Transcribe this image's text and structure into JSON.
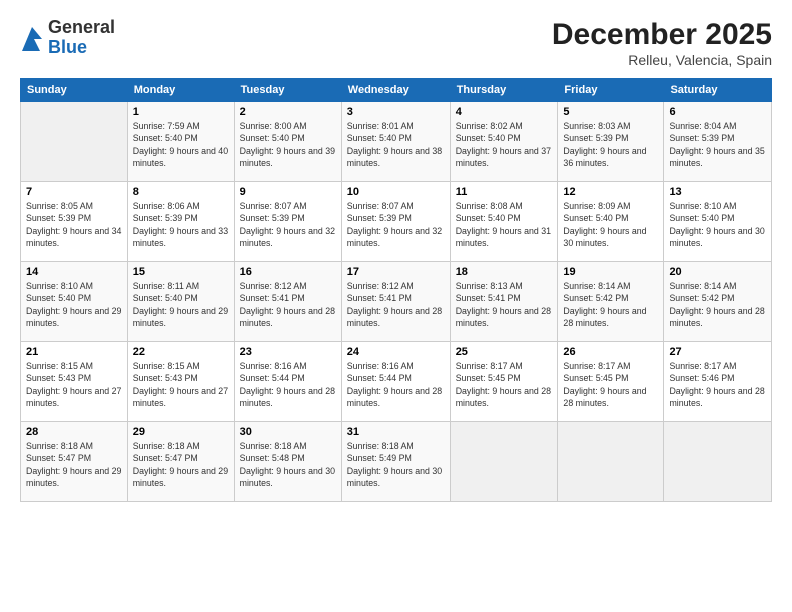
{
  "header": {
    "logo_general": "General",
    "logo_blue": "Blue",
    "month_title": "December 2025",
    "location": "Relleu, Valencia, Spain"
  },
  "days_of_week": [
    "Sunday",
    "Monday",
    "Tuesday",
    "Wednesday",
    "Thursday",
    "Friday",
    "Saturday"
  ],
  "weeks": [
    [
      {
        "day": "",
        "sunrise": "",
        "sunset": "",
        "daylight": ""
      },
      {
        "day": "1",
        "sunrise": "Sunrise: 7:59 AM",
        "sunset": "Sunset: 5:40 PM",
        "daylight": "Daylight: 9 hours and 40 minutes."
      },
      {
        "day": "2",
        "sunrise": "Sunrise: 8:00 AM",
        "sunset": "Sunset: 5:40 PM",
        "daylight": "Daylight: 9 hours and 39 minutes."
      },
      {
        "day": "3",
        "sunrise": "Sunrise: 8:01 AM",
        "sunset": "Sunset: 5:40 PM",
        "daylight": "Daylight: 9 hours and 38 minutes."
      },
      {
        "day": "4",
        "sunrise": "Sunrise: 8:02 AM",
        "sunset": "Sunset: 5:40 PM",
        "daylight": "Daylight: 9 hours and 37 minutes."
      },
      {
        "day": "5",
        "sunrise": "Sunrise: 8:03 AM",
        "sunset": "Sunset: 5:39 PM",
        "daylight": "Daylight: 9 hours and 36 minutes."
      },
      {
        "day": "6",
        "sunrise": "Sunrise: 8:04 AM",
        "sunset": "Sunset: 5:39 PM",
        "daylight": "Daylight: 9 hours and 35 minutes."
      }
    ],
    [
      {
        "day": "7",
        "sunrise": "Sunrise: 8:05 AM",
        "sunset": "Sunset: 5:39 PM",
        "daylight": "Daylight: 9 hours and 34 minutes."
      },
      {
        "day": "8",
        "sunrise": "Sunrise: 8:06 AM",
        "sunset": "Sunset: 5:39 PM",
        "daylight": "Daylight: 9 hours and 33 minutes."
      },
      {
        "day": "9",
        "sunrise": "Sunrise: 8:07 AM",
        "sunset": "Sunset: 5:39 PM",
        "daylight": "Daylight: 9 hours and 32 minutes."
      },
      {
        "day": "10",
        "sunrise": "Sunrise: 8:07 AM",
        "sunset": "Sunset: 5:39 PM",
        "daylight": "Daylight: 9 hours and 32 minutes."
      },
      {
        "day": "11",
        "sunrise": "Sunrise: 8:08 AM",
        "sunset": "Sunset: 5:40 PM",
        "daylight": "Daylight: 9 hours and 31 minutes."
      },
      {
        "day": "12",
        "sunrise": "Sunrise: 8:09 AM",
        "sunset": "Sunset: 5:40 PM",
        "daylight": "Daylight: 9 hours and 30 minutes."
      },
      {
        "day": "13",
        "sunrise": "Sunrise: 8:10 AM",
        "sunset": "Sunset: 5:40 PM",
        "daylight": "Daylight: 9 hours and 30 minutes."
      }
    ],
    [
      {
        "day": "14",
        "sunrise": "Sunrise: 8:10 AM",
        "sunset": "Sunset: 5:40 PM",
        "daylight": "Daylight: 9 hours and 29 minutes."
      },
      {
        "day": "15",
        "sunrise": "Sunrise: 8:11 AM",
        "sunset": "Sunset: 5:40 PM",
        "daylight": "Daylight: 9 hours and 29 minutes."
      },
      {
        "day": "16",
        "sunrise": "Sunrise: 8:12 AM",
        "sunset": "Sunset: 5:41 PM",
        "daylight": "Daylight: 9 hours and 28 minutes."
      },
      {
        "day": "17",
        "sunrise": "Sunrise: 8:12 AM",
        "sunset": "Sunset: 5:41 PM",
        "daylight": "Daylight: 9 hours and 28 minutes."
      },
      {
        "day": "18",
        "sunrise": "Sunrise: 8:13 AM",
        "sunset": "Sunset: 5:41 PM",
        "daylight": "Daylight: 9 hours and 28 minutes."
      },
      {
        "day": "19",
        "sunrise": "Sunrise: 8:14 AM",
        "sunset": "Sunset: 5:42 PM",
        "daylight": "Daylight: 9 hours and 28 minutes."
      },
      {
        "day": "20",
        "sunrise": "Sunrise: 8:14 AM",
        "sunset": "Sunset: 5:42 PM",
        "daylight": "Daylight: 9 hours and 28 minutes."
      }
    ],
    [
      {
        "day": "21",
        "sunrise": "Sunrise: 8:15 AM",
        "sunset": "Sunset: 5:43 PM",
        "daylight": "Daylight: 9 hours and 27 minutes."
      },
      {
        "day": "22",
        "sunrise": "Sunrise: 8:15 AM",
        "sunset": "Sunset: 5:43 PM",
        "daylight": "Daylight: 9 hours and 27 minutes."
      },
      {
        "day": "23",
        "sunrise": "Sunrise: 8:16 AM",
        "sunset": "Sunset: 5:44 PM",
        "daylight": "Daylight: 9 hours and 28 minutes."
      },
      {
        "day": "24",
        "sunrise": "Sunrise: 8:16 AM",
        "sunset": "Sunset: 5:44 PM",
        "daylight": "Daylight: 9 hours and 28 minutes."
      },
      {
        "day": "25",
        "sunrise": "Sunrise: 8:17 AM",
        "sunset": "Sunset: 5:45 PM",
        "daylight": "Daylight: 9 hours and 28 minutes."
      },
      {
        "day": "26",
        "sunrise": "Sunrise: 8:17 AM",
        "sunset": "Sunset: 5:45 PM",
        "daylight": "Daylight: 9 hours and 28 minutes."
      },
      {
        "day": "27",
        "sunrise": "Sunrise: 8:17 AM",
        "sunset": "Sunset: 5:46 PM",
        "daylight": "Daylight: 9 hours and 28 minutes."
      }
    ],
    [
      {
        "day": "28",
        "sunrise": "Sunrise: 8:18 AM",
        "sunset": "Sunset: 5:47 PM",
        "daylight": "Daylight: 9 hours and 29 minutes."
      },
      {
        "day": "29",
        "sunrise": "Sunrise: 8:18 AM",
        "sunset": "Sunset: 5:47 PM",
        "daylight": "Daylight: 9 hours and 29 minutes."
      },
      {
        "day": "30",
        "sunrise": "Sunrise: 8:18 AM",
        "sunset": "Sunset: 5:48 PM",
        "daylight": "Daylight: 9 hours and 30 minutes."
      },
      {
        "day": "31",
        "sunrise": "Sunrise: 8:18 AM",
        "sunset": "Sunset: 5:49 PM",
        "daylight": "Daylight: 9 hours and 30 minutes."
      },
      {
        "day": "",
        "sunrise": "",
        "sunset": "",
        "daylight": ""
      },
      {
        "day": "",
        "sunrise": "",
        "sunset": "",
        "daylight": ""
      },
      {
        "day": "",
        "sunrise": "",
        "sunset": "",
        "daylight": ""
      }
    ]
  ]
}
